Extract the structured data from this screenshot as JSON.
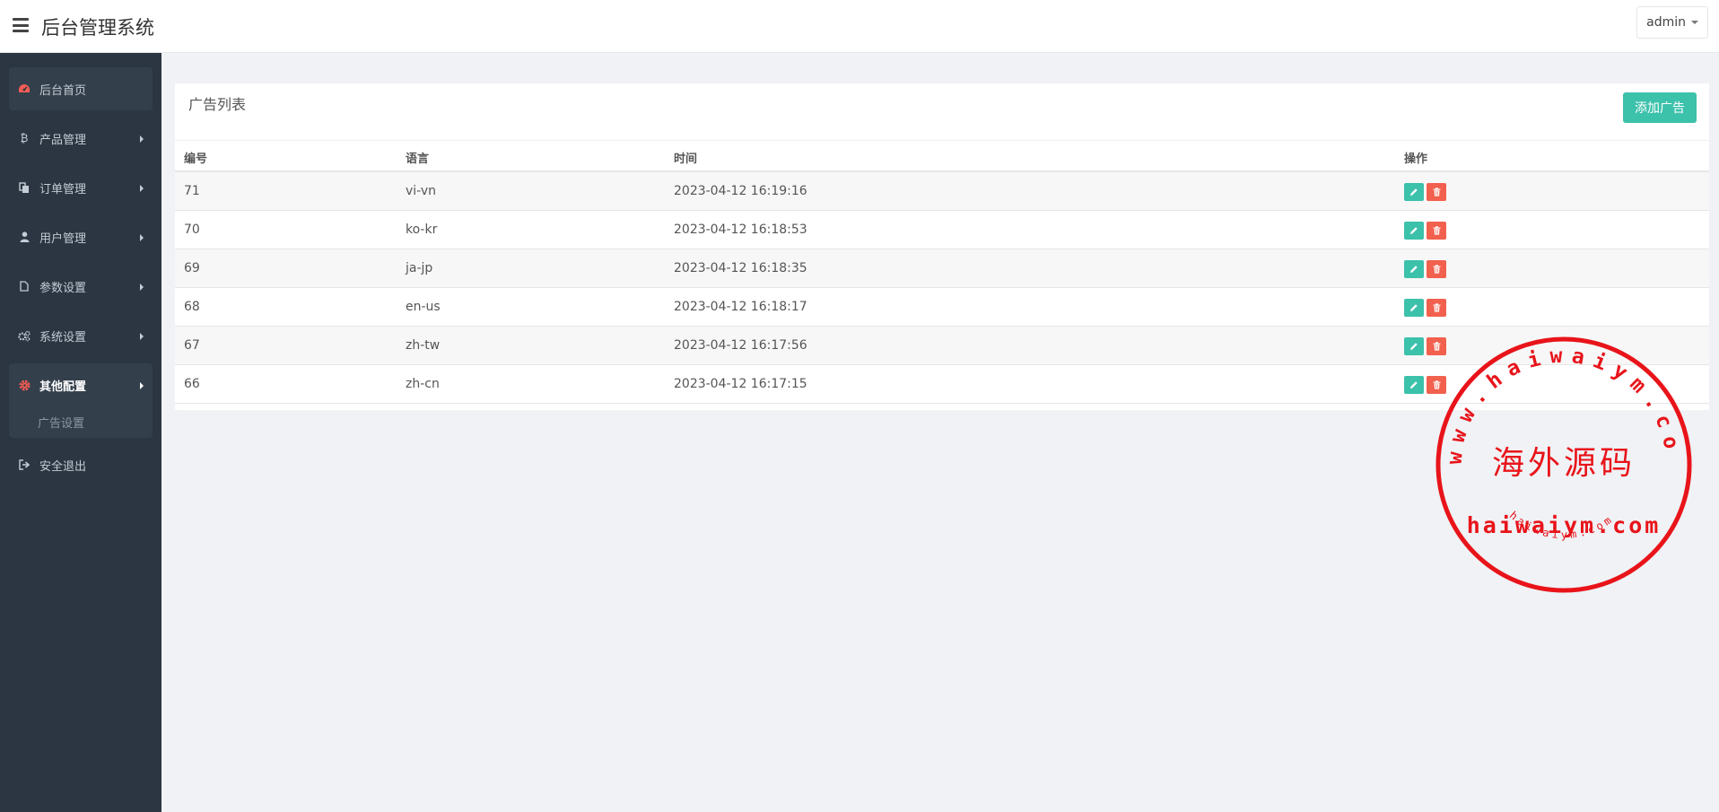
{
  "header": {
    "app_title": "后台管理系统",
    "user_name": "admin"
  },
  "sidebar": {
    "items": [
      {
        "label": "后台首页",
        "icon": "dashboard-icon"
      },
      {
        "label": "产品管理",
        "icon": "bitcoin-icon"
      },
      {
        "label": "订单管理",
        "icon": "copy-icon"
      },
      {
        "label": "用户管理",
        "icon": "user-icon"
      },
      {
        "label": "参数设置",
        "icon": "file-icon"
      },
      {
        "label": "系统设置",
        "icon": "gears-icon"
      },
      {
        "label": "其他配置",
        "icon": "gear-icon"
      },
      {
        "label": "安全退出",
        "icon": "sign-out-icon"
      }
    ],
    "submenu": [
      {
        "label": "广告设置"
      }
    ]
  },
  "panel": {
    "title": "广告列表",
    "add_button": "添加广告",
    "columns": [
      "编号",
      "语言",
      "时间",
      "操作"
    ],
    "rows": [
      {
        "id": "71",
        "lang": "vi-vn",
        "time": "2023-04-12 16:19:16"
      },
      {
        "id": "70",
        "lang": "ko-kr",
        "time": "2023-04-12 16:18:53"
      },
      {
        "id": "69",
        "lang": "ja-jp",
        "time": "2023-04-12 16:18:35"
      },
      {
        "id": "68",
        "lang": "en-us",
        "time": "2023-04-12 16:18:17"
      },
      {
        "id": "67",
        "lang": "zh-tw",
        "time": "2023-04-12 16:17:56"
      },
      {
        "id": "66",
        "lang": "zh-cn",
        "time": "2023-04-12 16:17:15"
      }
    ]
  },
  "watermark": {
    "arc_text": "www.haiwaiym.com",
    "center_text": "海外源码",
    "domain_text": "haiwaiym.com",
    "bottom_text": "haiwaiym.com",
    "color": "#e8141a"
  },
  "colors": {
    "accent": "#3cc1ab",
    "danger": "#f2604e",
    "sidebar_bg": "#2b3642"
  }
}
